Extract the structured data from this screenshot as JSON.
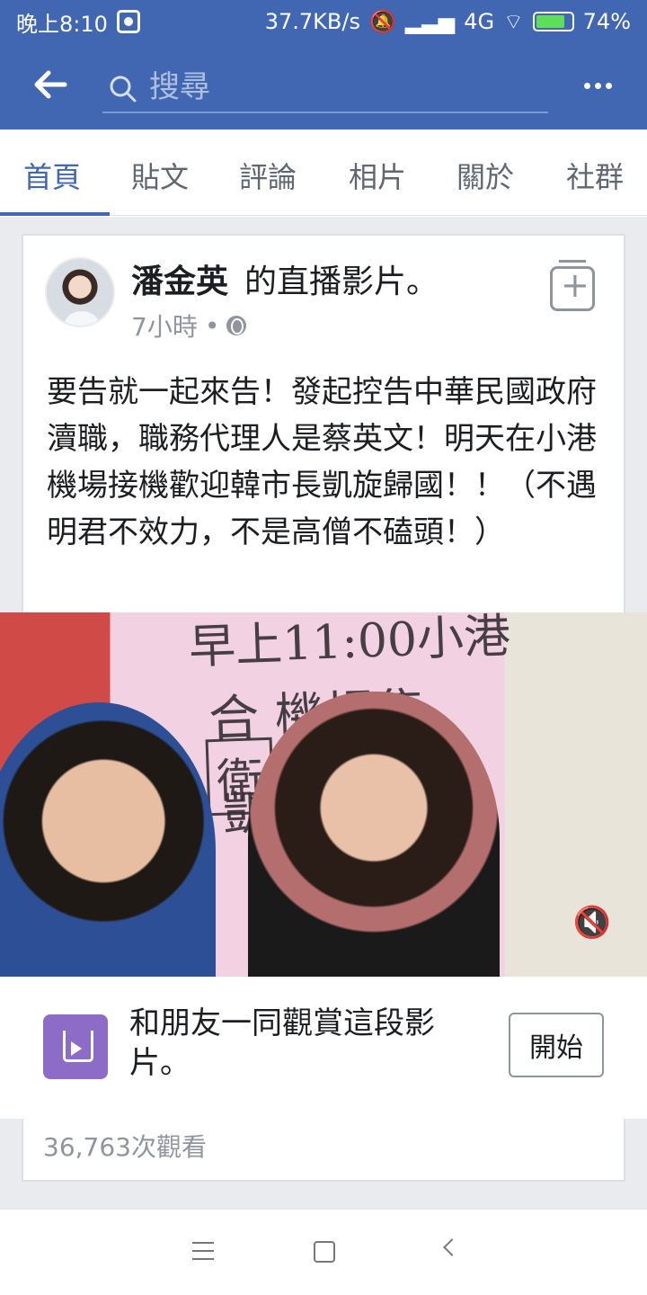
{
  "status_bar": {
    "time": "晚上8:10",
    "network_speed": "37.7KB/s",
    "network_type": "4G",
    "battery": "74%"
  },
  "app_bar": {
    "search_placeholder": "搜尋",
    "icons": [
      "back-arrow-icon",
      "search-icon",
      "more-icon"
    ]
  },
  "tabs": [
    {
      "label": "首頁",
      "active": true
    },
    {
      "label": "貼文",
      "active": false
    },
    {
      "label": "評論",
      "active": false
    },
    {
      "label": "相片",
      "active": false
    },
    {
      "label": "關於",
      "active": false
    },
    {
      "label": "社群",
      "active": false
    }
  ],
  "post": {
    "author": "潘金英",
    "author_suffix": "的直播影片。",
    "time": "7小時",
    "separator": "•",
    "text": "要告就一起來告！發起控告中華民國政府瀆職，職務代理人是蔡英文！明天在小港機場接機歡迎韓市長凱旋歸國！！（不遇明君不效力，不是高僧不磕頭！）",
    "views": "36,763次觀看"
  },
  "watch_party": {
    "text": "和朋友一同觀賞這段影片。",
    "button": "開始"
  },
  "colors": {
    "facebook_blue": "#4267b2",
    "text_secondary": "#90949c",
    "background": "#e9ebee"
  }
}
